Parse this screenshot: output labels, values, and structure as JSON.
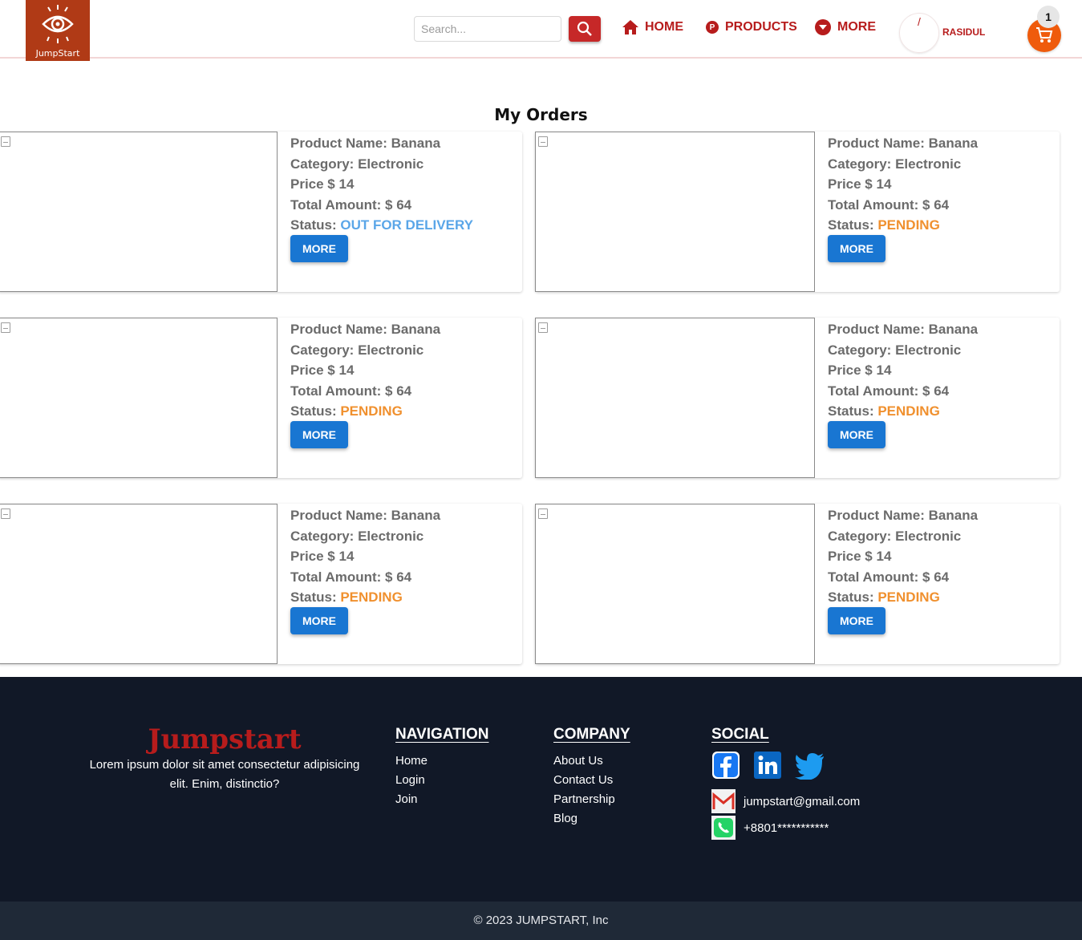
{
  "header": {
    "logo_text": "JumpStart",
    "search_placeholder": "Search...",
    "nav": {
      "home": "HOME",
      "products": "PRODUCTS",
      "products_badge": "P",
      "more": "MORE"
    },
    "avatar_mark": "/",
    "username": "RASIDUL",
    "cart_count": "1"
  },
  "page_title": "My Orders",
  "orders": [
    {
      "product": "Product Name: Banana",
      "category": "Category: Electronic",
      "price": "Price $ 14",
      "total": "Total Amount: $ 64",
      "status_label": "Status: ",
      "status": "OUT FOR DELIVERY",
      "button": "MORE"
    },
    {
      "product": "Product Name: Banana",
      "category": "Category: Electronic",
      "price": "Price $ 14",
      "total": "Total Amount: $ 64",
      "status_label": "Status: ",
      "status": "PENDING",
      "button": "MORE"
    },
    {
      "product": "Product Name: Banana",
      "category": "Category: Electronic",
      "price": "Price $ 14",
      "total": "Total Amount: $ 64",
      "status_label": "Status: ",
      "status": "PENDING",
      "button": "MORE"
    },
    {
      "product": "Product Name: Banana",
      "category": "Category: Electronic",
      "price": "Price $ 14",
      "total": "Total Amount: $ 64",
      "status_label": "Status: ",
      "status": "PENDING",
      "button": "MORE"
    },
    {
      "product": "Product Name: Banana",
      "category": "Category: Electronic",
      "price": "Price $ 14",
      "total": "Total Amount: $ 64",
      "status_label": "Status: ",
      "status": "PENDING",
      "button": "MORE"
    },
    {
      "product": "Product Name: Banana",
      "category": "Category: Electronic",
      "price": "Price $ 14",
      "total": "Total Amount: $ 64",
      "status_label": "Status: ",
      "status": "PENDING",
      "button": "MORE"
    }
  ],
  "footer": {
    "brand": "Jumpstart",
    "description": "Lorem ipsum dolor sit amet consectetur adipisicing elit. Enim, distinctio?",
    "navigation": {
      "heading": "NAVIGATION",
      "links": [
        "Home",
        "Login",
        "Join"
      ]
    },
    "company": {
      "heading": "COMPANY",
      "links": [
        "About Us",
        "Contact Us",
        "Partnership",
        "Blog"
      ]
    },
    "social": {
      "heading": "SOCIAL",
      "email": "jumpstart@gmail.com",
      "phone": "+8801***********"
    },
    "copyright": "© 2023 JUMPSTART, Inc"
  },
  "colors": {
    "brand_red": "#b71c1c",
    "logo_bg": "#b03a16",
    "cart_orange": "#ef5b0c",
    "button_blue": "#1976d2",
    "status_delivery": "#5aa6e8",
    "status_pending": "#f0902e",
    "footer_bg": "#111827"
  }
}
